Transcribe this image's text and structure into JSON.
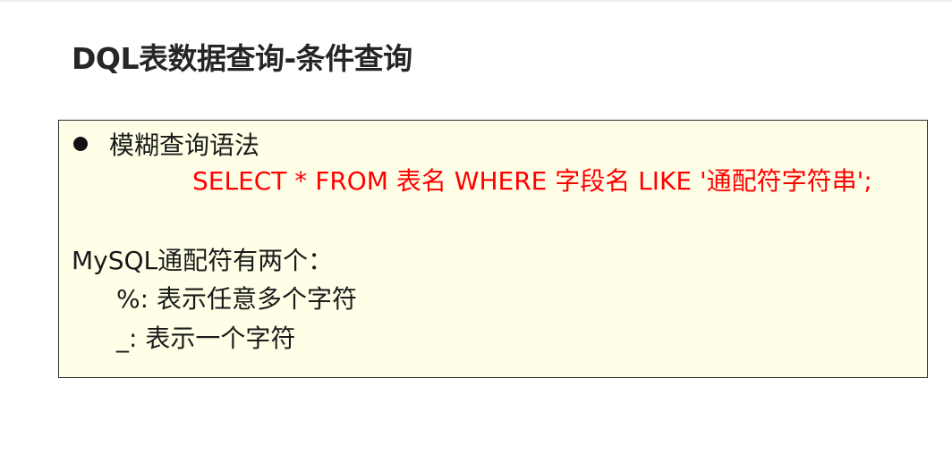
{
  "slide": {
    "title": "DQL表数据查询-条件查询"
  },
  "content": {
    "bullet": "模糊查询语法",
    "sql": "SELECT * FROM 表名 WHERE 字段名 LIKE '通配符字符串';",
    "wildcards_header": "MySQL通配符有两个：",
    "wildcard_percent": "%: 表示任意多个字符",
    "wildcard_underscore": "_: 表示一个字符"
  },
  "colors": {
    "box_background": "#ffffe8",
    "sql_text": "#ff0000"
  }
}
